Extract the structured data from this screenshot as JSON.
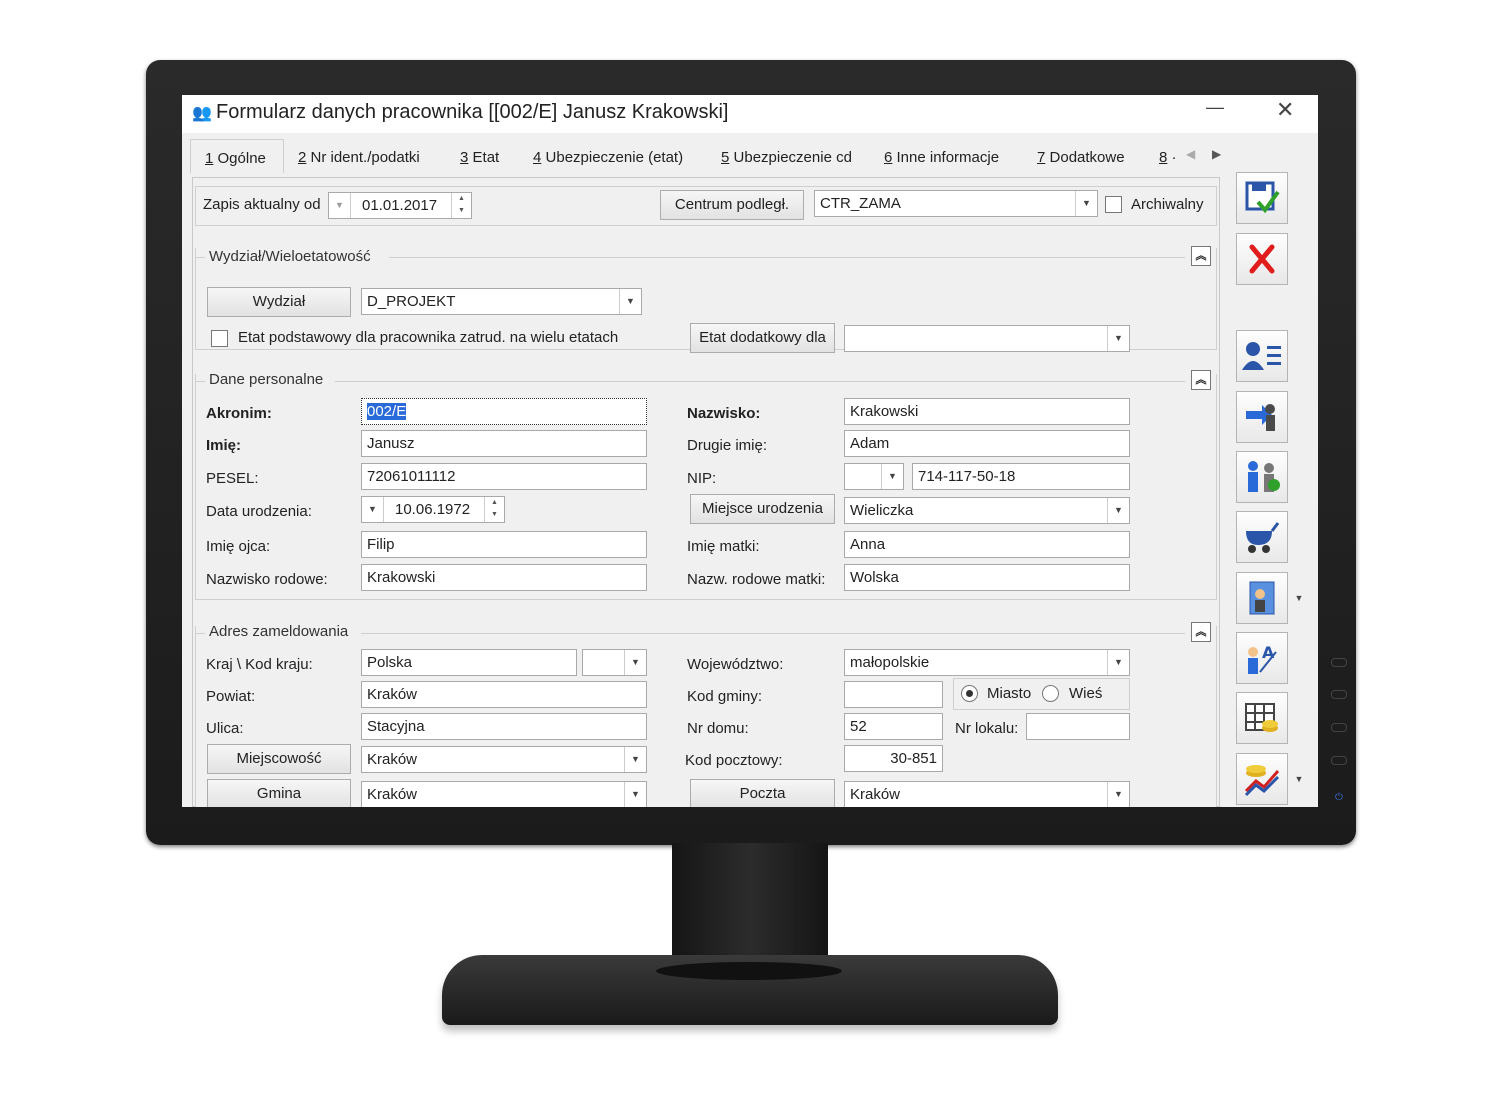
{
  "window": {
    "title": "Formularz danych pracownika [[002/E] Janusz Krakowski]",
    "minimize": "—",
    "close": "✕"
  },
  "tabs": [
    {
      "num": "1",
      "label": "Ogólne"
    },
    {
      "num": "2",
      "label": "Nr ident./podatki"
    },
    {
      "num": "3",
      "label": "Etat"
    },
    {
      "num": "4",
      "label": "Ubezpieczenie (etat)"
    },
    {
      "num": "5",
      "label": "Ubezpieczenie cd"
    },
    {
      "num": "6",
      "label": "Inne informacje"
    },
    {
      "num": "7",
      "label": "Dodatkowe"
    },
    {
      "num": "8",
      "label": "·"
    }
  ],
  "top": {
    "zapis_label": "Zapis aktualny od",
    "zapis_date": "01.01.2017",
    "centrum_button": "Centrum podległ.",
    "centrum_value": "CTR_ZAMA",
    "archiwalny_label": "Archiwalny"
  },
  "wydzial": {
    "section_title": "Wydział/Wieloetatowość",
    "wydzial_button": "Wydział",
    "wydzial_value": "D_PROJEKT",
    "etat_checkbox_label": "Etat podstawowy dla pracownika zatrud. na wielu etatach",
    "etat_dodatkowy_button": "Etat dodatkowy dla",
    "etat_dodatkowy_value": ""
  },
  "personal": {
    "section_title": "Dane personalne",
    "akronim_label": "Akronim:",
    "akronim_value": "002/E",
    "imie_label": "Imię:",
    "imie_value": "Janusz",
    "pesel_label": "PESEL:",
    "pesel_value": "72061011112",
    "data_ur_label": "Data urodzenia:",
    "data_ur_value": "10.06.1972",
    "imie_ojca_label": "Imię ojca:",
    "imie_ojca_value": "Filip",
    "nazw_rodowe_label": "Nazwisko rodowe:",
    "nazw_rodowe_value": "Krakowski",
    "nazwisko_label": "Nazwisko:",
    "nazwisko_value": "Krakowski",
    "drugie_imie_label": "Drugie imię:",
    "drugie_imie_value": "Adam",
    "nip_label": "NIP:",
    "nip_value": "714-117-50-18",
    "miejsce_ur_button": "Miejsce urodzenia",
    "miejsce_ur_value": "Wieliczka",
    "imie_matki_label": "Imię matki:",
    "imie_matki_value": "Anna",
    "nazw_rod_matki_label": "Nazw. rodowe matki:",
    "nazw_rod_matki_value": "Wolska"
  },
  "address": {
    "section_title": "Adres zameldowania",
    "kraj_label": "Kraj \\ Kod kraju:",
    "kraj_value": "Polska",
    "powiat_label": "Powiat:",
    "powiat_value": "Kraków",
    "ulica_label": "Ulica:",
    "ulica_value": "Stacyjna",
    "miejscowosc_button": "Miejscowość",
    "miejscowosc_value": "Kraków",
    "gmina_button": "Gmina",
    "gmina_value": "Kraków",
    "woj_label": "Województwo:",
    "woj_value": "małopolskie",
    "kod_gminy_label": "Kod gminy:",
    "kod_gminy_value": "",
    "miasto_label": "Miasto",
    "wies_label": "Wieś",
    "nr_domu_label": "Nr domu:",
    "nr_domu_value": "52",
    "nr_lokalu_label": "Nr lokalu:",
    "nr_lokalu_value": "",
    "kod_pocztowy_label": "Kod pocztowy:",
    "kod_pocztowy_value": "30-851",
    "poczta_button": "Poczta",
    "poczta_value": "Kraków"
  },
  "toolbar": {
    "icons": [
      "save-icon",
      "cancel-icon",
      "employee-card-icon",
      "employee-arrow-icon",
      "family-icon",
      "baby-carriage-icon",
      "person-document-icon",
      "person-letter-icon",
      "grid-coins-icon",
      "chart-coins-icon"
    ]
  }
}
